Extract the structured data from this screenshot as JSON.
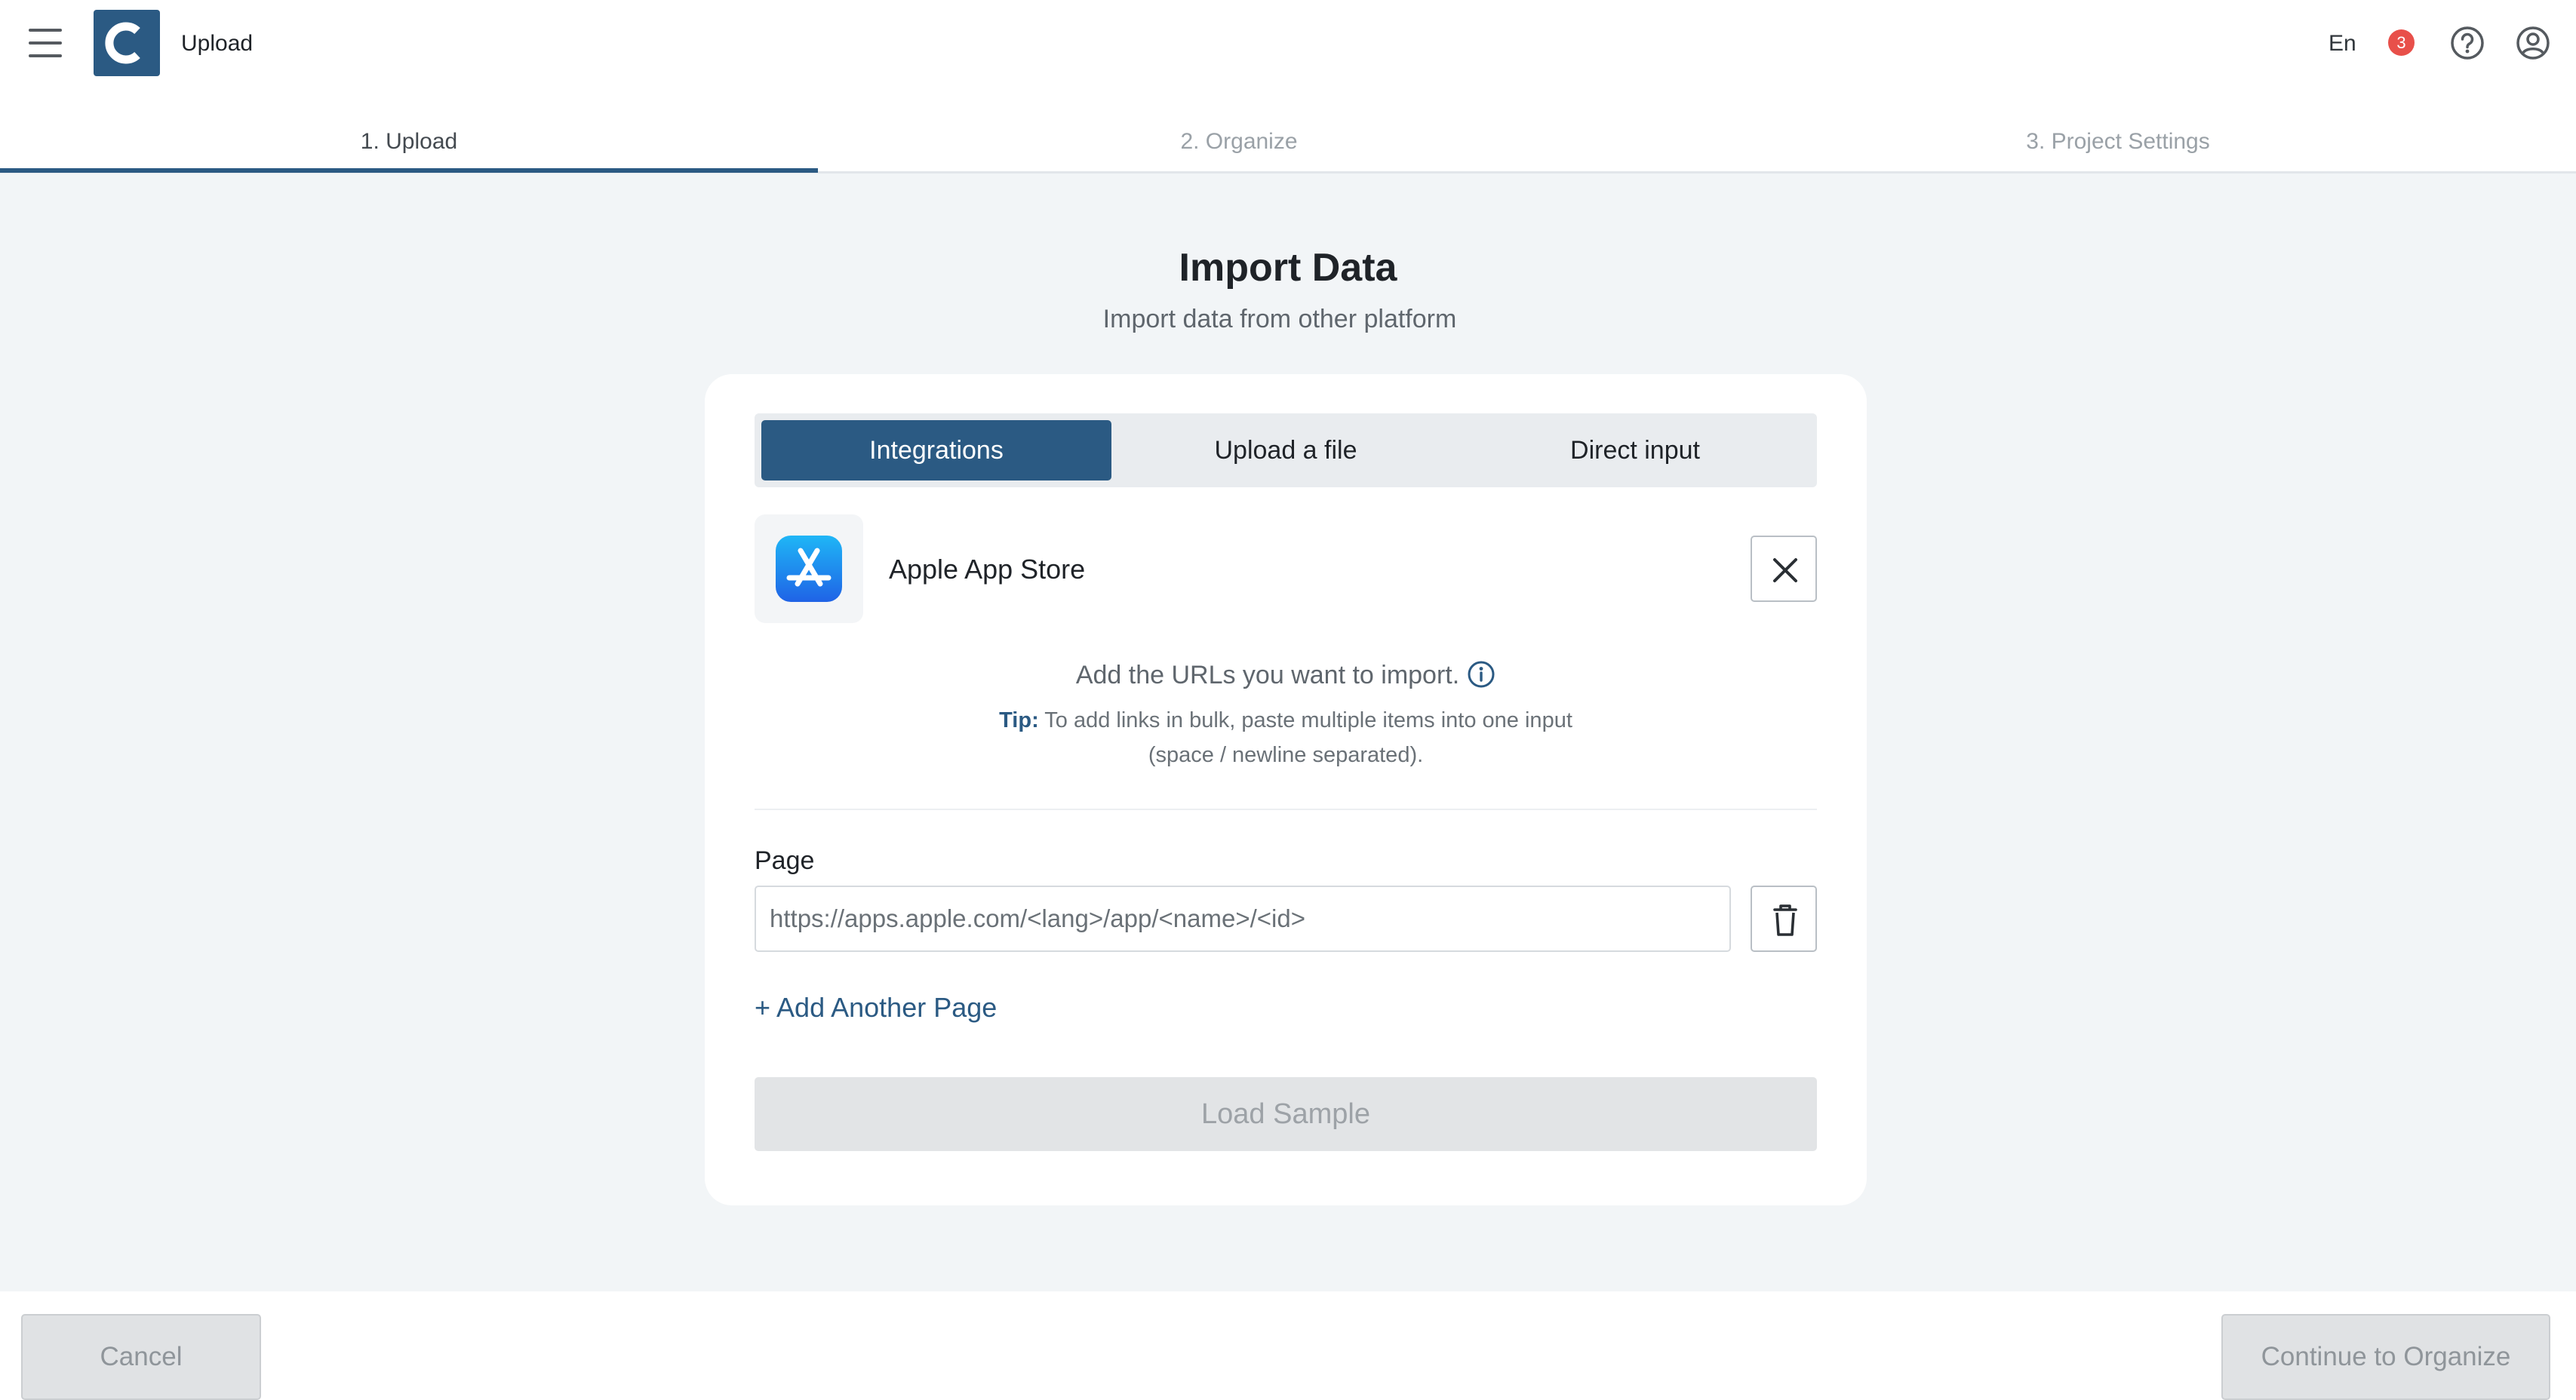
{
  "header": {
    "app_title": "Upload",
    "language": "En",
    "notification_count": "3",
    "icons": [
      "menu-icon",
      "logo-icon",
      "help-icon",
      "account-icon"
    ]
  },
  "stepper": {
    "steps": [
      {
        "label": "1. Upload",
        "active": true
      },
      {
        "label": "2. Organize",
        "active": false
      },
      {
        "label": "3. Project Settings",
        "active": false
      }
    ]
  },
  "page": {
    "title": "Import Data",
    "subtitle": "Import data from other platform"
  },
  "tabs": [
    {
      "label": "Integrations",
      "active": true
    },
    {
      "label": "Upload a file",
      "active": false
    },
    {
      "label": "Direct input",
      "active": false
    }
  ],
  "integration": {
    "name": "Apple App Store",
    "icon": "app-store-icon"
  },
  "instructions": {
    "main": "Add the URLs you want to import.",
    "tip_label": "Tip:",
    "tip_line1": " To add links in bulk, paste multiple items into one input",
    "tip_line2": "(space / newline separated)."
  },
  "form": {
    "field_label": "Page",
    "url_placeholder": "https://apps.apple.com/<lang>/app/<name>/<id>",
    "url_value": "",
    "add_page_label": "+ Add Another Page",
    "load_sample_label": "Load Sample"
  },
  "footer": {
    "cancel_label": "Cancel",
    "continue_label": "Continue to Organize"
  },
  "colors": {
    "primary": "#2b5a83",
    "badge": "#e8504a",
    "background": "#f2f5f7",
    "disabled": "#e0e2e4"
  }
}
